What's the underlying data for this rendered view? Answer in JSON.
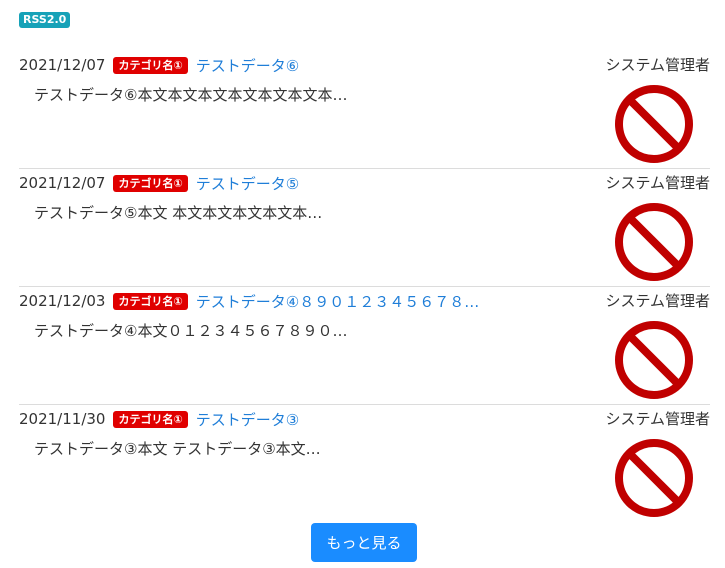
{
  "feed_badge": "RSS2.0",
  "entries": [
    {
      "date": "2021/12/07",
      "category": "カテゴリ名①",
      "title": "テストデータ⑥",
      "author": "システム管理者",
      "excerpt": "テストデータ⑥本文本文本文本文本文本文本…",
      "image_icon": "no-image-icon"
    },
    {
      "date": "2021/12/07",
      "category": "カテゴリ名①",
      "title": "テストデータ⑤",
      "author": "システム管理者",
      "excerpt": "テストデータ⑤本文 本文本文本文本文本…",
      "image_icon": "no-image-icon"
    },
    {
      "date": "2021/12/03",
      "category": "カテゴリ名①",
      "title": "テストデータ④８９０１２３４５６７８…",
      "author": "システム管理者",
      "excerpt": "テストデータ④本文０１２３４５６７８９０…",
      "image_icon": "no-image-icon"
    },
    {
      "date": "2021/11/30",
      "category": "カテゴリ名①",
      "title": "テストデータ③",
      "author": "システム管理者",
      "excerpt": "テストデータ③本文 テストデータ③本文…",
      "image_icon": "no-image-icon"
    }
  ],
  "more_button": "もっと見る",
  "colors": {
    "badge": "#17a2b8",
    "category": "#e00000",
    "link": "#1f7ed8",
    "button": "#1a8cff",
    "no_image": "#c00000"
  }
}
